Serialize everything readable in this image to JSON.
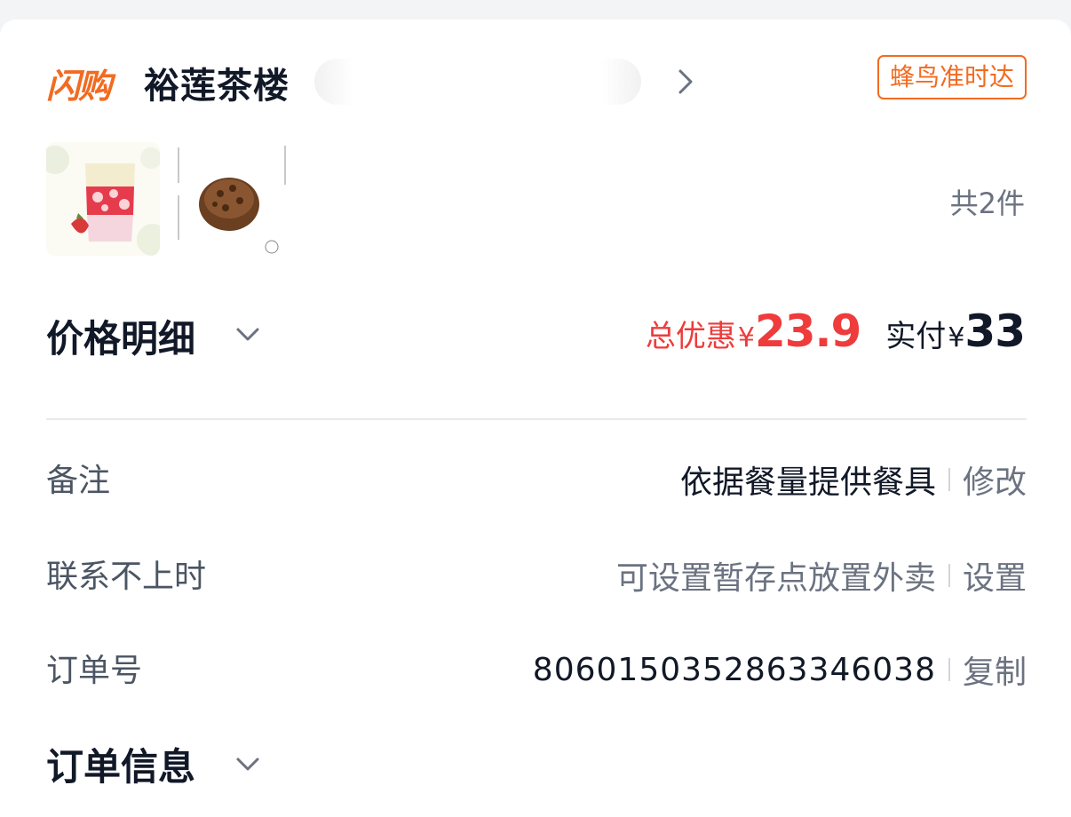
{
  "header": {
    "brand_logo_text": "闪购",
    "shop_name": "裕莲茶楼",
    "delivery_badge": "蜂鸟准时达"
  },
  "products": {
    "item_count": "共2件"
  },
  "price": {
    "section_title": "价格明细",
    "discount_label": "总优惠",
    "currency": "¥",
    "discount_value": "23.9",
    "paid_label": "实付",
    "paid_value": "33"
  },
  "rows": {
    "note": {
      "label": "备注",
      "value": "依据餐量提供餐具",
      "action": "修改"
    },
    "unreachable": {
      "label": "联系不上时",
      "value": "可设置暂存点放置外卖",
      "action": "设置"
    },
    "order_no": {
      "label": "订单号",
      "value": "8060150352863346038",
      "action": "复制"
    }
  },
  "order_info": {
    "section_title": "订单信息"
  },
  "colors": {
    "brand_orange": "#f26b21",
    "discount_red": "#ef3b3b",
    "text_primary": "#111827",
    "text_muted": "#6b7280"
  }
}
